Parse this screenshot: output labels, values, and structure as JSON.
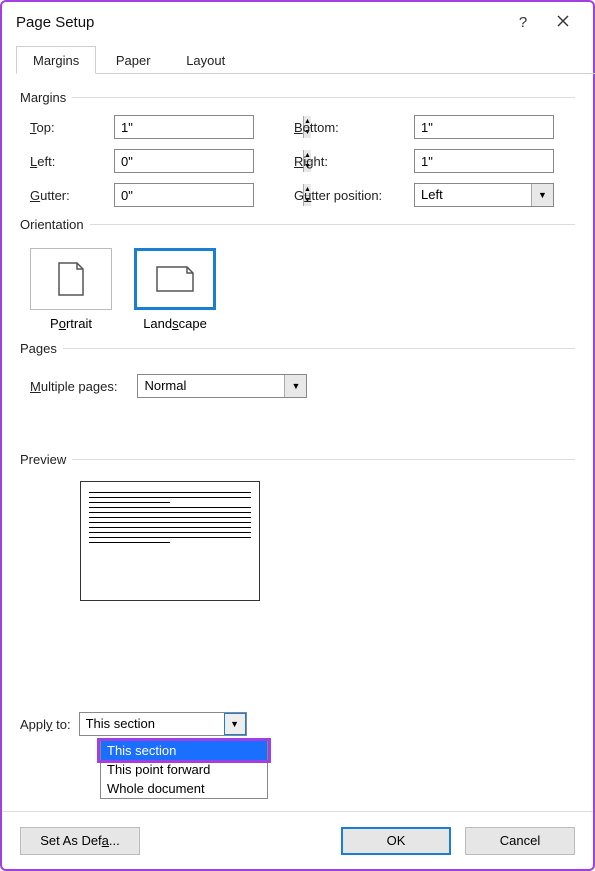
{
  "window": {
    "title": "Page Setup"
  },
  "tabs": {
    "margins": "Margins",
    "paper": "Paper",
    "layout": "Layout"
  },
  "sections": {
    "margins": "Margins",
    "orientation": "Orientation",
    "pages": "Pages",
    "preview": "Preview"
  },
  "margins": {
    "top_label": "Top:",
    "top_value": "1\"",
    "bottom_label": "Bottom:",
    "bottom_value": "1\"",
    "left_label": "Left:",
    "left_value": "0\"",
    "right_label": "Right:",
    "right_value": "1\"",
    "gutter_label": "Gutter:",
    "gutter_value": "0\"",
    "gutter_pos_label": "Gutter position:",
    "gutter_pos_value": "Left"
  },
  "orientation": {
    "portrait": "Portrait",
    "landscape": "Landscape",
    "selected": "landscape"
  },
  "pages": {
    "multiple_label": "Multiple pages:",
    "multiple_value": "Normal"
  },
  "apply": {
    "label": "Apply to:",
    "value": "This section",
    "options": [
      "This section",
      "This point forward",
      "Whole document"
    ],
    "selected_index": 0
  },
  "buttons": {
    "default": "Set As Default",
    "ok": "OK",
    "cancel": "Cancel"
  }
}
